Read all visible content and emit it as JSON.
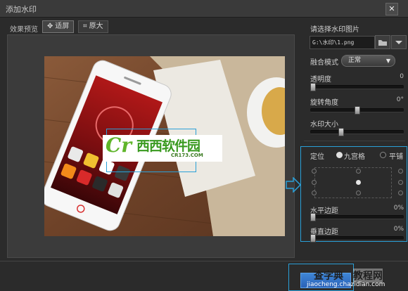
{
  "window": {
    "title": "添加水印",
    "close_glyph": "✕"
  },
  "preview": {
    "label": "效果预览",
    "fit_label": "适屏",
    "original_label": "原大"
  },
  "panel": {
    "image_label": "请选择水印图片",
    "image_path": "G:\\水印\\1.png",
    "blend_label": "融合模式",
    "blend_value": "正常",
    "opacity_label": "透明度",
    "opacity_value": "0",
    "opacity_level": 0,
    "rotation_label": "旋转角度",
    "rotation_value": "0°",
    "rotation_level": 0.5,
    "size_label": "水印大小",
    "size_level": 0.32,
    "position_label": "定位",
    "position_grid_label": "九宫格",
    "position_tile_label": "平铺",
    "h_margin_label": "水平边距",
    "h_margin_value": "0%",
    "h_margin_level": 0,
    "v_margin_label": "垂直边距",
    "v_margin_value": "0%",
    "v_margin_level": 0
  },
  "watermark": {
    "brand": "西西软件园",
    "url": "CR173.COM",
    "logo_letter": "Cr"
  },
  "site_watermark": {
    "line1": "查字典",
    "line2": "教程网",
    "url": "jiaocheng.chazidian.com"
  },
  "colors": {
    "accent": "#2aa0d8",
    "ok_button": "#2f6fc6",
    "watermark_green": "#5fb52a"
  }
}
